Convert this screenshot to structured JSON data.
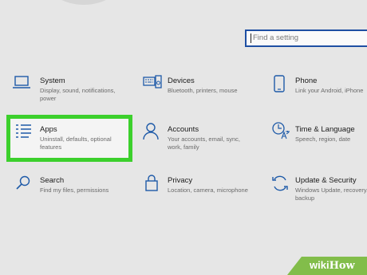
{
  "search": {
    "placeholder": "Find a setting"
  },
  "tiles": {
    "system": {
      "title": "System",
      "desc": "Display, sound, notifications, power",
      "icon": "laptop-icon"
    },
    "devices": {
      "title": "Devices",
      "desc": "Bluetooth, printers, mouse",
      "icon": "keyboard-speaker-icon"
    },
    "phone": {
      "title": "Phone",
      "desc": "Link your Android, iPhone",
      "icon": "phone-icon"
    },
    "apps": {
      "title": "Apps",
      "desc": "Uninstall, defaults, optional features",
      "icon": "apps-list-icon",
      "highlighted": true
    },
    "accounts": {
      "title": "Accounts",
      "desc": "Your accounts, email, sync, work, family",
      "icon": "person-icon"
    },
    "time": {
      "title": "Time & Language",
      "desc": "Speech, region, date",
      "icon": "time-language-icon"
    },
    "search": {
      "title": "Search",
      "desc": "Find my files, permissions",
      "icon": "search-icon"
    },
    "privacy": {
      "title": "Privacy",
      "desc": "Location, camera, microphone",
      "icon": "lock-icon"
    },
    "update": {
      "title": "Update & Security",
      "desc": "Windows Update, recovery, backup",
      "icon": "refresh-icon"
    }
  },
  "watermark": {
    "wiki": "wiki",
    "how": "How"
  },
  "colors": {
    "accent": "#1e5aa8",
    "highlight": "#3cd02c",
    "watermark": "#82bd4a"
  }
}
